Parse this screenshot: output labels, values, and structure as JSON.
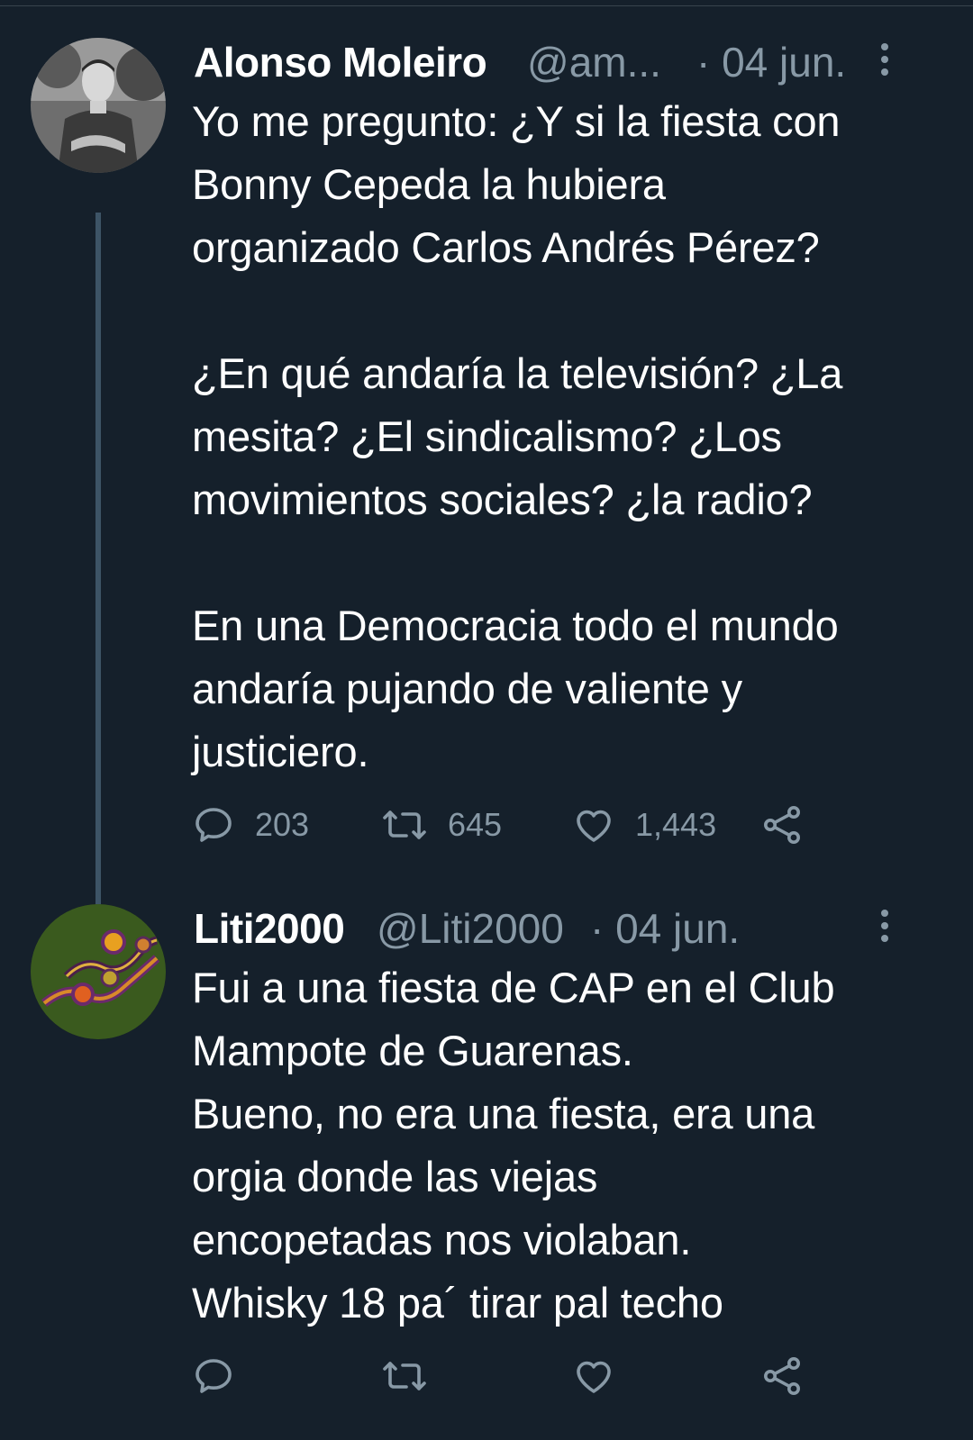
{
  "tweets": [
    {
      "display_name": "Alonso Moleiro",
      "handle": "@am...",
      "date": "· 04 jun.",
      "text": "Yo me pregunto: ¿Y si la fiesta con\nBonny Cepeda la hubiera\norganizado Carlos Andrés Pérez?\n\n¿En qué andaría la televisión? ¿La\nmesita? ¿El sindicalismo? ¿Los\nmovimientos sociales? ¿la radio?\n\nEn una Democracia todo el mundo\nandaría pujando de valiente y\njusticiero.",
      "replies": "203",
      "retweets": "645",
      "likes": "1,443",
      "icons": {
        "reply": "reply-icon",
        "retweet": "retweet-icon",
        "like": "heart-icon",
        "share": "share-icon",
        "more": "more-vertical-icon"
      }
    },
    {
      "display_name": "Liti2000",
      "handle": "@Liti2000",
      "date": "· 04 jun.",
      "text": "Fui a una fiesta de CAP en el Club\nMampote de Guarenas.\nBueno, no era una fiesta, era una\norgia donde las viejas\nencopetadas nos violaban.\nWhisky 18 pa´ tirar pal techo",
      "icons": {
        "reply": "reply-icon",
        "retweet": "retweet-icon",
        "like": "heart-icon",
        "share": "share-icon",
        "more": "more-vertical-icon"
      }
    }
  ],
  "colors": {
    "background": "#15202b",
    "text": "#ffffff",
    "secondary": "#8899a6",
    "thread_line": "#3d5466"
  }
}
